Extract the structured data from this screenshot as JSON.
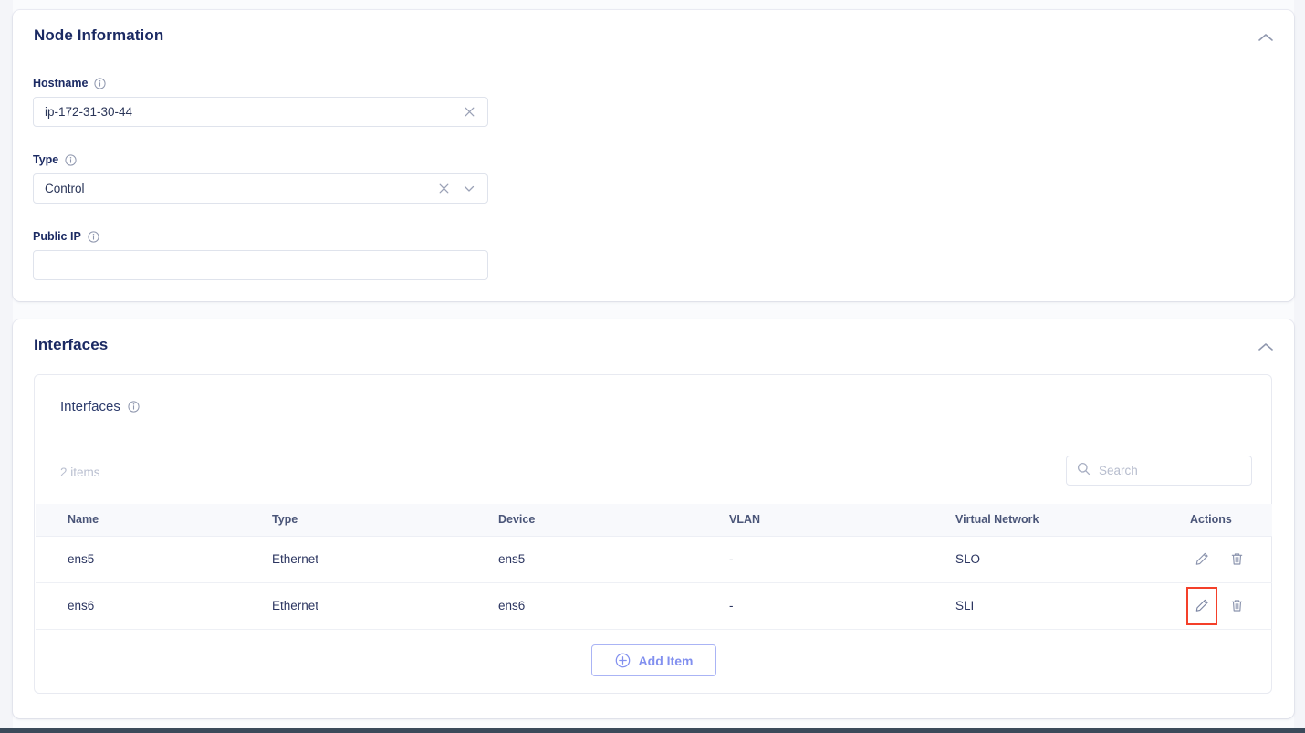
{
  "sections": {
    "node": {
      "title": "Node Information",
      "collapse_icon": "chevron-up-icon",
      "fields": [
        {
          "label": "Hostname",
          "info_icon": "info-icon",
          "value": "ip-172-31-30-44",
          "placeholder": "",
          "clear_icon": "close-icon",
          "kind": "text"
        },
        {
          "label": "Type",
          "info_icon": "info-icon",
          "value": "Control",
          "placeholder": "",
          "clear_icon": "close-icon",
          "dropdown_icon": "chevron-down-icon",
          "kind": "select"
        },
        {
          "label": "Public IP",
          "info_icon": "info-icon",
          "value": "",
          "placeholder": "",
          "kind": "text"
        }
      ]
    },
    "interfaces": {
      "title": "Interfaces",
      "collapse_icon": "chevron-up-icon",
      "panel_title": "Interfaces",
      "panel_info_icon": "info-icon",
      "items_count": "2 items",
      "search": {
        "icon": "search-icon",
        "value": "",
        "placeholder": "Search"
      },
      "table": {
        "columns": [
          "Name",
          "Type",
          "Device",
          "VLAN",
          "Virtual Network",
          "Actions"
        ],
        "rows": [
          {
            "name": "ens5",
            "type": "Ethernet",
            "device": "ens5",
            "vlan": "-",
            "virtual_network": "SLO",
            "edit_icon": "pencil-icon",
            "delete_icon": "trash-icon",
            "edit_highlighted": false
          },
          {
            "name": "ens6",
            "type": "Ethernet",
            "device": "ens6",
            "vlan": "-",
            "virtual_network": "SLI",
            "edit_icon": "pencil-icon",
            "delete_icon": "trash-icon",
            "edit_highlighted": true
          }
        ]
      },
      "add_button": {
        "label": "Add Item",
        "icon": "plus-circle-icon"
      }
    }
  },
  "colors": {
    "heading": "#1b2a63",
    "accent_blue": "#8290ef",
    "highlight_red": "#f4402a",
    "muted": "#b9bfd0",
    "page_bg": "#fafbfd",
    "bottom_bar": "#3b4a5a"
  }
}
